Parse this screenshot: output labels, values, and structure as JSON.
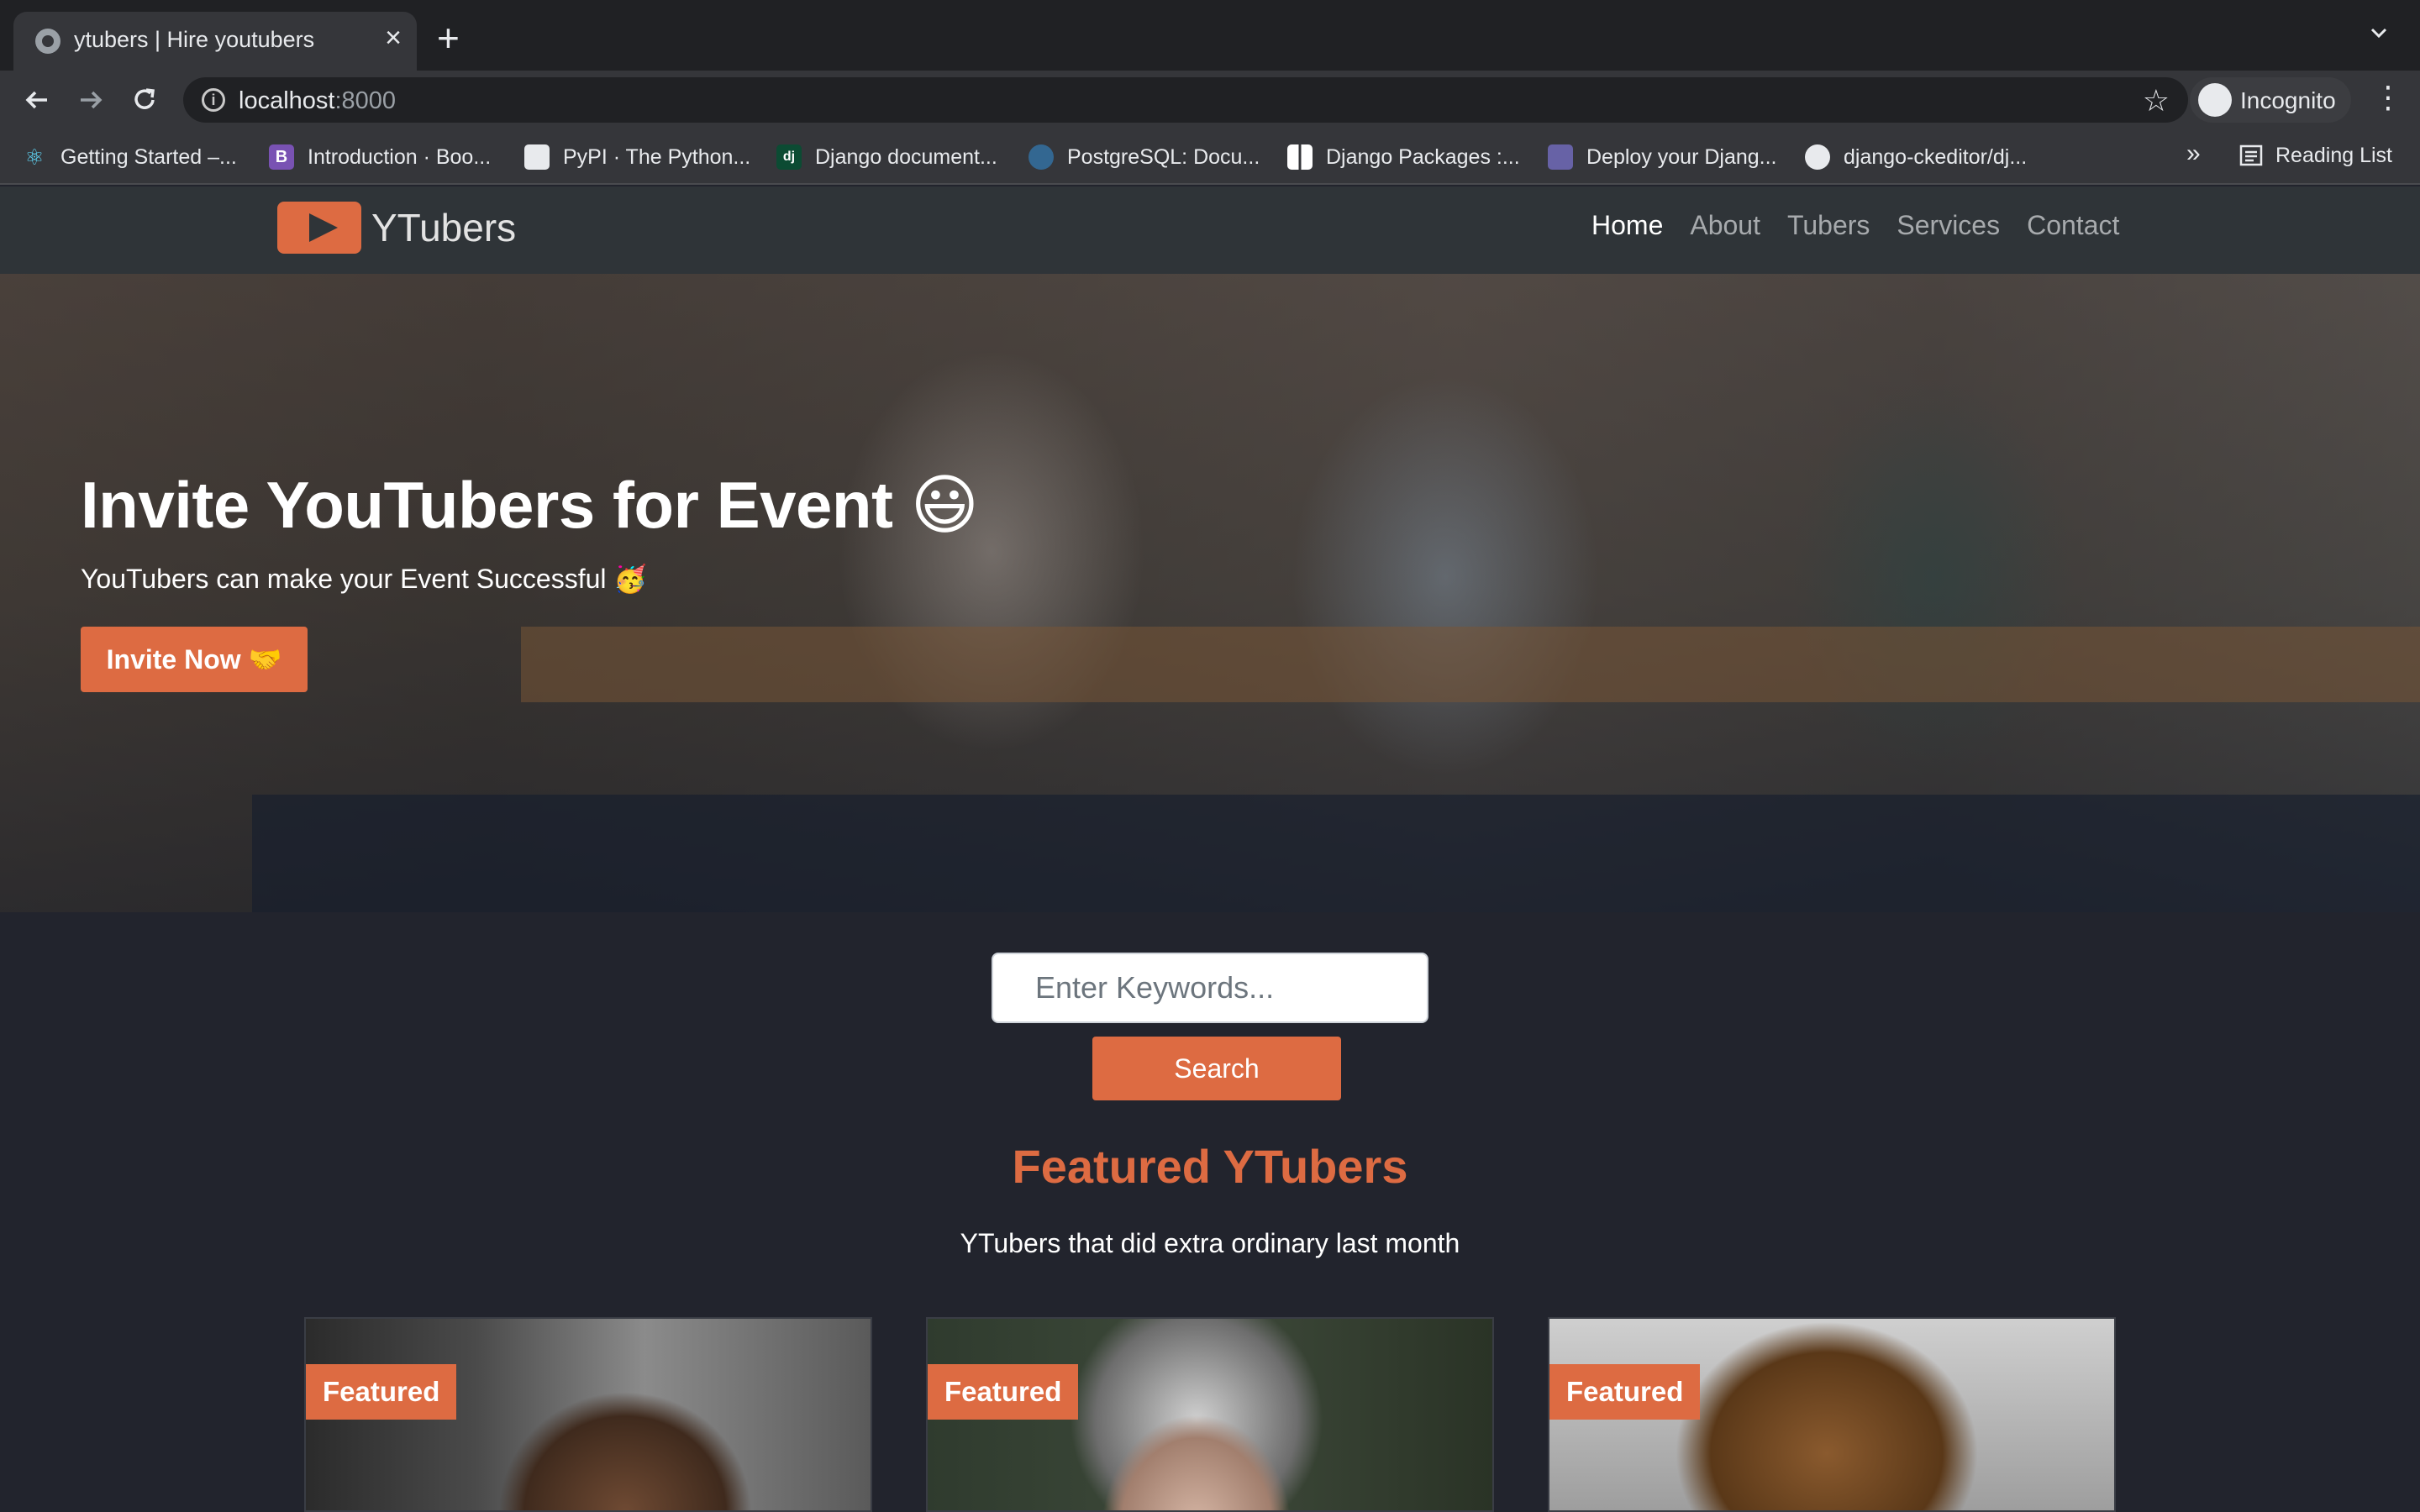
{
  "browser": {
    "tab_title": "ytubers | Hire youtubers",
    "url_host": "localhost",
    "url_port": ":8000",
    "profile_label": "Incognito",
    "bookmarks": [
      {
        "label": "Getting Started –...",
        "icon": "react-icon",
        "color": "#61dafb"
      },
      {
        "label": "Introduction · Boo...",
        "icon": "bootstrap-icon",
        "color": "#7952b3"
      },
      {
        "label": "PyPI · The Python...",
        "icon": "pypi-icon",
        "color": "#ffffff"
      },
      {
        "label": "Django document...",
        "icon": "django-icon",
        "color": "#0c4b33"
      },
      {
        "label": "PostgreSQL: Docu...",
        "icon": "postgresql-icon",
        "color": "#336791"
      },
      {
        "label": "Django Packages :...",
        "icon": "django-packages-icon",
        "color": "#ffffff"
      },
      {
        "label": "Deploy your Djang...",
        "icon": "heroku-icon",
        "color": "#6762a6"
      },
      {
        "label": "django-ckeditor/dj...",
        "icon": "github-icon",
        "color": "#ffffff"
      }
    ],
    "reading_list_label": "Reading List",
    "bm_icon_glyphs": {
      "bootstrap": "B",
      "django": "dj"
    }
  },
  "site": {
    "brand": "YTubers",
    "nav": [
      {
        "label": "Home",
        "active": true
      },
      {
        "label": "About",
        "active": false
      },
      {
        "label": "Tubers",
        "active": false
      },
      {
        "label": "Services",
        "active": false
      },
      {
        "label": "Contact",
        "active": false
      }
    ],
    "hero": {
      "title": "Invite YouTubers for Event 😃",
      "subtitle": "YouTubers can make your Event Successful 🥳",
      "cta": "Invite Now 🤝"
    },
    "search": {
      "placeholder": "Enter Keywords...",
      "button": "Search"
    },
    "featured": {
      "title": "Featured YTubers",
      "subtitle": "YTubers that did extra ordinary last month",
      "cards": [
        {
          "badge": "Featured"
        },
        {
          "badge": "Featured"
        },
        {
          "badge": "Featured"
        }
      ]
    },
    "accent_color": "#dd6b42"
  }
}
